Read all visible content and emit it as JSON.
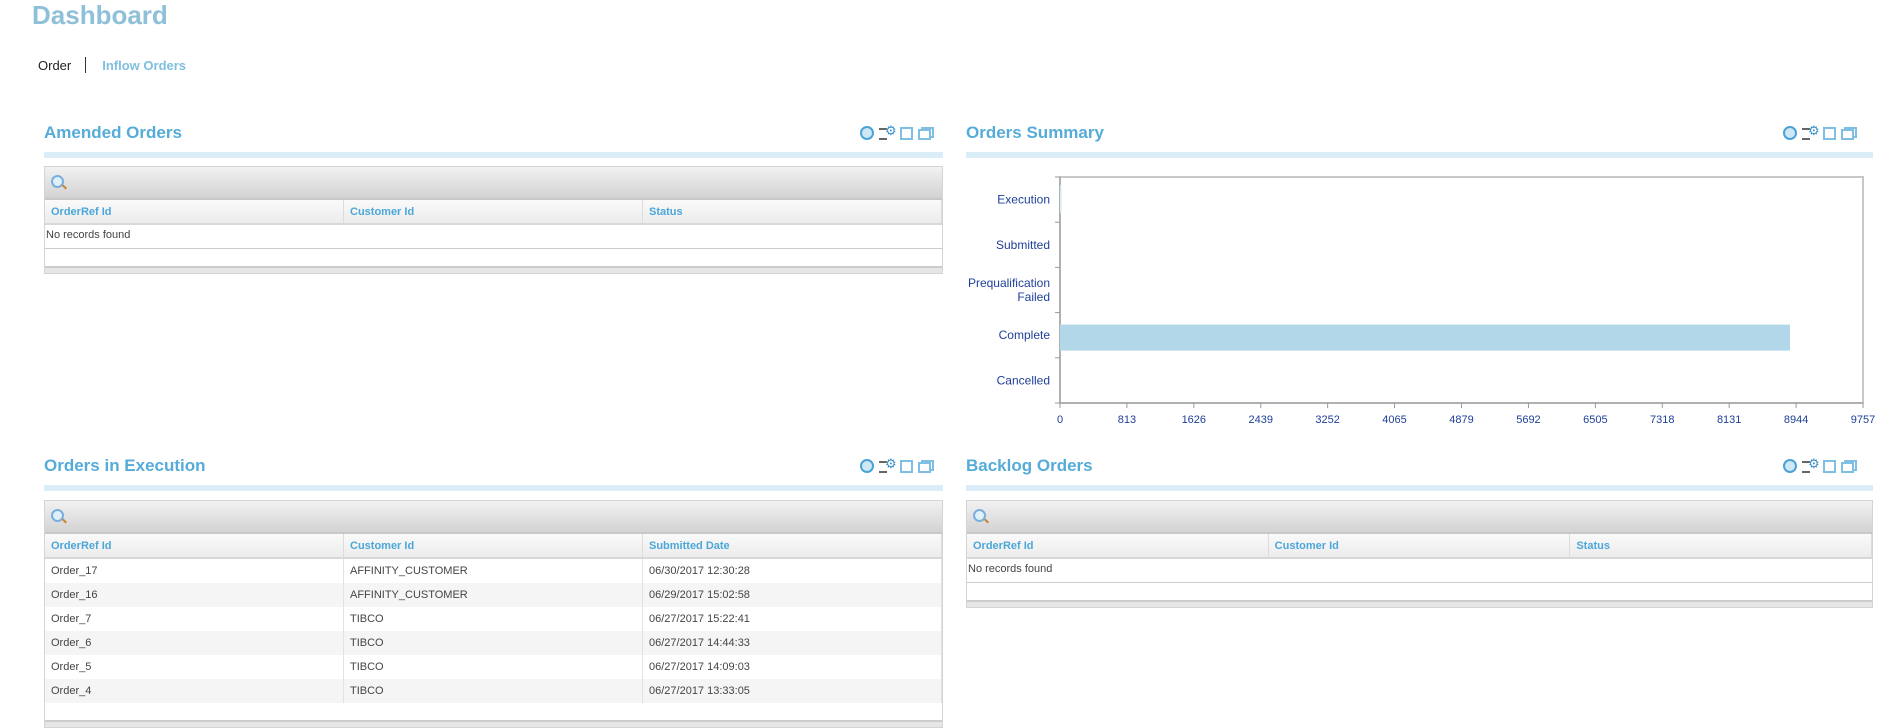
{
  "page_title": "Dashboard",
  "tabs": [
    {
      "label": "Order",
      "active": true
    },
    {
      "label": "Inflow Orders",
      "active": false
    }
  ],
  "panels": {
    "amended": {
      "title": "Amended Orders",
      "columns": [
        "OrderRef Id",
        "Customer Id",
        "Status"
      ],
      "empty_text": "No records found"
    },
    "summary": {
      "title": "Orders Summary"
    },
    "execution": {
      "title": "Orders in Execution",
      "columns": [
        "OrderRef Id",
        "Customer Id",
        "Submitted Date"
      ],
      "rows": [
        [
          "Order_17",
          "AFFINITY_CUSTOMER",
          "06/30/2017 12:30:28"
        ],
        [
          "Order_16",
          "AFFINITY_CUSTOMER",
          "06/29/2017 15:02:58"
        ],
        [
          "Order_7",
          "TIBCO",
          "06/27/2017 15:22:41"
        ],
        [
          "Order_6",
          "TIBCO",
          "06/27/2017 14:44:33"
        ],
        [
          "Order_5",
          "TIBCO",
          "06/27/2017 14:09:03"
        ],
        [
          "Order_4",
          "TIBCO",
          "06/27/2017 13:33:05"
        ]
      ]
    },
    "backlog": {
      "title": "Backlog Orders",
      "columns": [
        "OrderRef Id",
        "Customer Id",
        "Status"
      ],
      "empty_text": "No records found"
    }
  },
  "icons": [
    "refresh-icon",
    "settings-icon",
    "maximize-icon",
    "restore-icon"
  ],
  "chart_data": {
    "type": "bar",
    "orientation": "horizontal",
    "categories": [
      "Execution",
      "Submitted",
      "Prequalification Failed",
      "Complete",
      "Cancelled"
    ],
    "category_lines": [
      [
        "Execution"
      ],
      [
        "Submitted"
      ],
      [
        "Prequalification",
        "Failed"
      ],
      [
        "Complete"
      ],
      [
        "Cancelled"
      ]
    ],
    "values": [
      6,
      0,
      0,
      8870,
      0
    ],
    "xlim": [
      0,
      9757
    ],
    "xticks": [
      "0",
      "813",
      "1626",
      "2439",
      "3252",
      "4065",
      "4879",
      "5692",
      "6505",
      "7318",
      "8131",
      "8944",
      "9757"
    ],
    "bar_color": "#b2d7e8"
  }
}
